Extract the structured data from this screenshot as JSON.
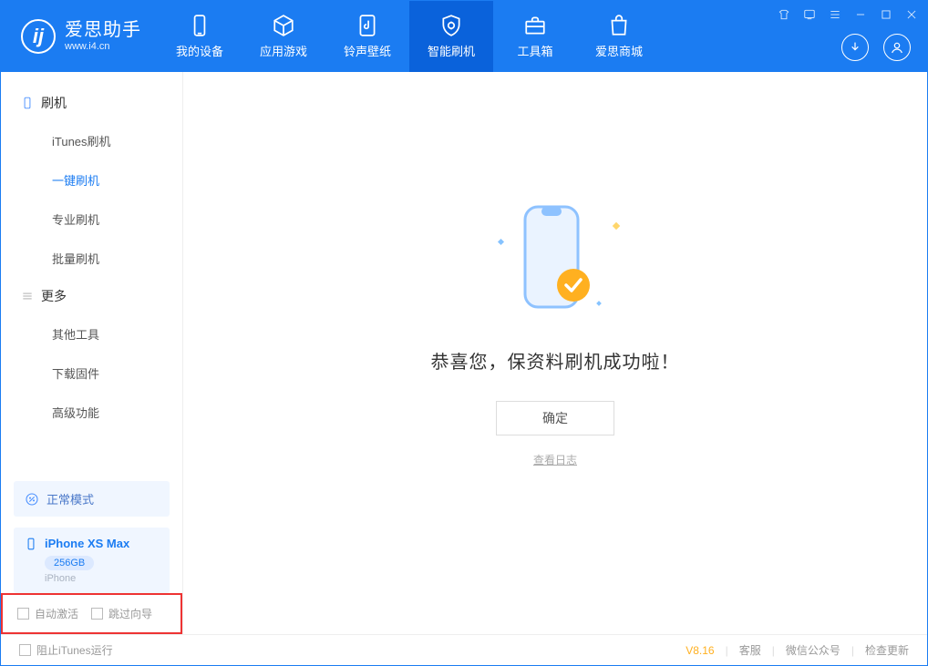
{
  "app": {
    "title": "爱思助手",
    "subtitle": "www.i4.cn"
  },
  "nav": {
    "items": [
      {
        "label": "我的设备"
      },
      {
        "label": "应用游戏"
      },
      {
        "label": "铃声壁纸"
      },
      {
        "label": "智能刷机"
      },
      {
        "label": "工具箱"
      },
      {
        "label": "爱思商城"
      }
    ],
    "active_index": 3
  },
  "sidebar": {
    "group_flash": {
      "label": "刷机"
    },
    "flash_items": [
      {
        "label": "iTunes刷机"
      },
      {
        "label": "一键刷机"
      },
      {
        "label": "专业刷机"
      },
      {
        "label": "批量刷机"
      }
    ],
    "flash_active_index": 1,
    "group_more": {
      "label": "更多"
    },
    "more_items": [
      {
        "label": "其他工具"
      },
      {
        "label": "下载固件"
      },
      {
        "label": "高级功能"
      }
    ],
    "mode_label": "正常模式",
    "device": {
      "name": "iPhone XS Max",
      "storage": "256GB",
      "type": "iPhone"
    },
    "opt_auto_activate": "自动激活",
    "opt_skip_guide": "跳过向导"
  },
  "main": {
    "headline": "恭喜您，保资料刷机成功啦！",
    "ok_button": "确定",
    "view_log": "查看日志"
  },
  "status": {
    "block_itunes": "阻止iTunes运行",
    "version": "V8.16",
    "support": "客服",
    "wechat": "微信公众号",
    "check_update": "检查更新"
  }
}
